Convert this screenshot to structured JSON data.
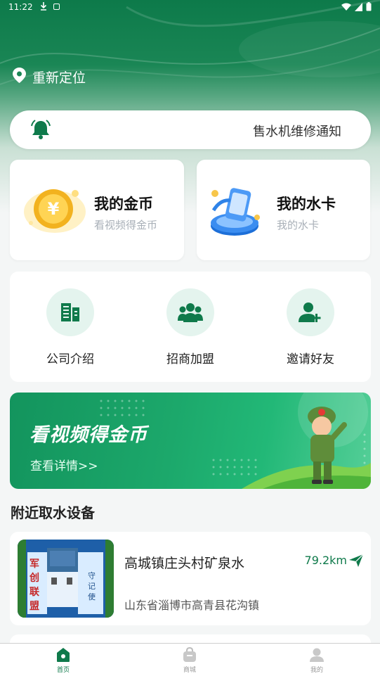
{
  "status_bar": {
    "time": "11:22"
  },
  "header": {
    "location_label": "重新定位"
  },
  "notice": {
    "text": "售水机维修通知"
  },
  "cards": [
    {
      "title": "我的金币",
      "subtitle": "看视频得金币",
      "icon": "gold-coin-icon"
    },
    {
      "title": "我的水卡",
      "subtitle": "我的水卡",
      "icon": "water-card-icon"
    }
  ],
  "menu": {
    "items": [
      {
        "label": "公司介绍",
        "icon": "building-icon"
      },
      {
        "label": "招商加盟",
        "icon": "group-icon"
      },
      {
        "label": "邀请好友",
        "icon": "add-user-icon"
      }
    ]
  },
  "banner": {
    "title": "看视频得金币",
    "link": "查看详情>>"
  },
  "nearby": {
    "title": "附近取水设备",
    "devices": [
      {
        "name": "高城镇庄头村矿泉水",
        "distance": "79.2km",
        "address": "山东省淄博市高青县花沟镇",
        "thumb_text": [
          "军",
          "创",
          "联",
          "盟"
        ]
      }
    ]
  },
  "tabbar": {
    "items": [
      {
        "label": "首页",
        "active": true
      },
      {
        "label": "商城",
        "active": false
      },
      {
        "label": "我的",
        "active": false
      }
    ]
  },
  "colors": {
    "brand": "#0f7a4b",
    "accent_light": "#e4f4ee"
  }
}
